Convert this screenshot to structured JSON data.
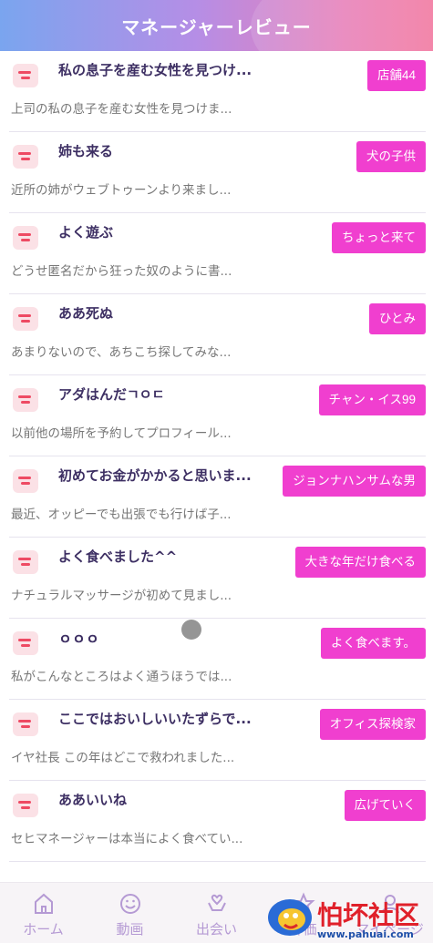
{
  "header": {
    "title": "マネージャーレビュー"
  },
  "reviews": [
    {
      "title": "私の息子を産む女性を見つけ...",
      "snippet": "上司の私の息子を産む女性を見つけま...",
      "tag": "店舗44"
    },
    {
      "title": "姉も来る",
      "snippet": "近所の姉がウェブトゥーンより来まし...",
      "tag": "犬の子供"
    },
    {
      "title": "よく遊ぶ",
      "snippet": "どうせ匿名だから狂った奴のように書...",
      "tag": "ちょっと来て"
    },
    {
      "title": "ああ死ぬ",
      "snippet": "あまりないので、あちこち探してみな...",
      "tag": "ひとみ"
    },
    {
      "title": "アダはんだㄱㅇㄷ",
      "snippet": "以前他の場所を予約してプロフィール...",
      "tag": "チャン・イス99"
    },
    {
      "title": "初めてお金がかかると思いま...",
      "snippet": "最近、オッピーでも出張でも行けば子...",
      "tag": "ジョンナハンサムな男"
    },
    {
      "title": "よく食べました^^",
      "snippet": "ナチュラルマッサージが初めて見まし...",
      "tag": "大きな年だけ食べる"
    },
    {
      "title": "ｏｏｏ",
      "snippet": "私がこんなところはよく通うほうでは...",
      "tag": "よく食べます。"
    },
    {
      "title": "ここではおいしいいたずらで...",
      "snippet": "イヤ社長 この年はどこで救われました...",
      "tag": "オフィス探検家"
    },
    {
      "title": "ああいいね",
      "snippet": "セヒマネージャーは本当によく食べてい...",
      "tag": "広げていく"
    }
  ],
  "nav": [
    {
      "label": "ホーム",
      "icon": "home-icon"
    },
    {
      "label": "動画",
      "icon": "smile-icon"
    },
    {
      "label": "出会い",
      "icon": "heart-hands-icon"
    },
    {
      "label": "評価",
      "icon": "star-icon"
    },
    {
      "label": "マイページ",
      "icon": "person-icon"
    }
  ],
  "watermark": {
    "text": "怕坏社区",
    "url": "www.pahuai.com"
  },
  "colors": {
    "tag": "#f03fcf",
    "title": "#3d2f63",
    "nav": "#b59ad4"
  }
}
